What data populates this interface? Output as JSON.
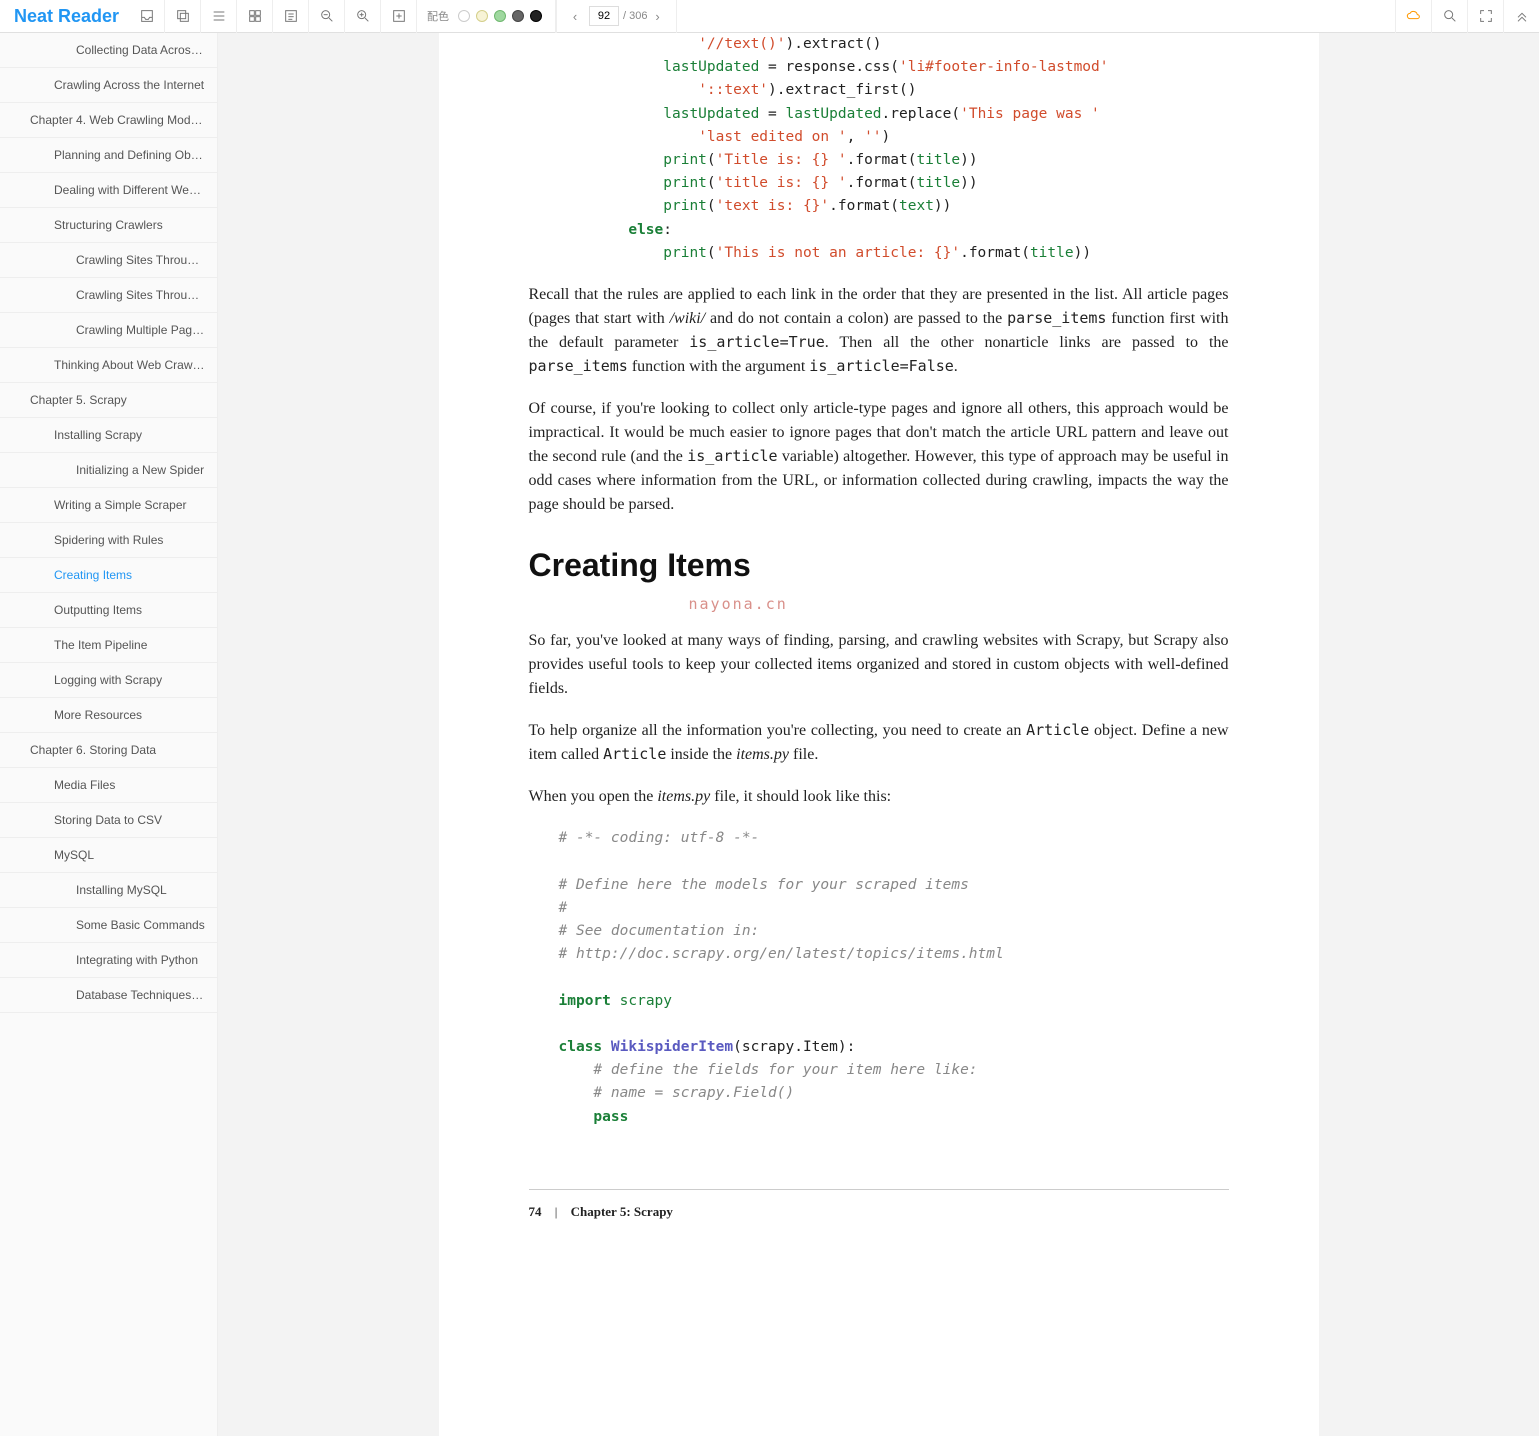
{
  "brand": "Neat Reader",
  "toolbar": {
    "color_label": "配色",
    "page_current": "92",
    "page_total": "/ 306"
  },
  "toc": [
    {
      "label": "Collecting Data Across …",
      "lvl": 3
    },
    {
      "label": "Crawling Across the Internet",
      "lvl": 2
    },
    {
      "label": "Chapter 4. Web Crawling Models",
      "lvl": 1
    },
    {
      "label": "Planning and Defining Objects",
      "lvl": 2
    },
    {
      "label": "Dealing with Different Websi…",
      "lvl": 2
    },
    {
      "label": "Structuring Crawlers",
      "lvl": 2
    },
    {
      "label": "Crawling Sites Through…",
      "lvl": 3
    },
    {
      "label": "Crawling Sites Through…",
      "lvl": 3
    },
    {
      "label": "Crawling Multiple Page …",
      "lvl": 3
    },
    {
      "label": "Thinking About Web Crawler…",
      "lvl": 2
    },
    {
      "label": "Chapter 5. Scrapy",
      "lvl": 1
    },
    {
      "label": "Installing Scrapy",
      "lvl": 2
    },
    {
      "label": "Initializing a New Spider",
      "lvl": 3
    },
    {
      "label": "Writing a Simple Scraper",
      "lvl": 2
    },
    {
      "label": "Spidering with Rules",
      "lvl": 2
    },
    {
      "label": "Creating Items",
      "lvl": 2,
      "active": true
    },
    {
      "label": "Outputting Items",
      "lvl": 2
    },
    {
      "label": "The Item Pipeline",
      "lvl": 2
    },
    {
      "label": "Logging with Scrapy",
      "lvl": 2
    },
    {
      "label": "More Resources",
      "lvl": 2
    },
    {
      "label": "Chapter 6. Storing Data",
      "lvl": 1
    },
    {
      "label": "Media Files",
      "lvl": 2
    },
    {
      "label": "Storing Data to CSV",
      "lvl": 2
    },
    {
      "label": "MySQL",
      "lvl": 2
    },
    {
      "label": "Installing MySQL",
      "lvl": 3
    },
    {
      "label": "Some Basic Commands",
      "lvl": 3
    },
    {
      "label": "Integrating with Python",
      "lvl": 3
    },
    {
      "label": "Database Techniques a…",
      "lvl": 3
    }
  ],
  "body": {
    "code1": {
      "l1a": "'//text()'",
      "l1b": ").extract()",
      "l2a": "lastUpdated",
      "l2b": " = response.css(",
      "l2c": "'li#footer-info-lastmod'",
      "l3a": "'::text'",
      "l3b": ").extract_first()",
      "l4a": "lastUpdated",
      "l4b": " = ",
      "l4c": "lastUpdated",
      "l4d": ".replace(",
      "l4e": "'This page was '",
      "l5a": "'last edited on '",
      "l5b": ", ",
      "l5c": "''",
      "l5d": ")",
      "l6a": "print",
      "l6b": "(",
      "l6c": "'Title is: {} '",
      "l6d": ".format(",
      "l6e": "title",
      "l6f": "))",
      "l7a": "print",
      "l7b": "(",
      "l7c": "'title is: {} '",
      "l7d": ".format(",
      "l7e": "title",
      "l7f": "))",
      "l8a": "print",
      "l8b": "(",
      "l8c": "'text is: {}'",
      "l8d": ".format(",
      "l8e": "text",
      "l8f": "))",
      "l9a": "else",
      "l9b": ":",
      "l10a": "print",
      "l10b": "(",
      "l10c": "'This is not an article: {}'",
      "l10d": ".format(",
      "l10e": "title",
      "l10f": "))"
    },
    "p1a": "Recall that the rules are applied to each link in the order that they are presented in the list. All article pages (pages that start with ",
    "p1b": "/wiki/",
    "p1c": " and do not contain a colon) are passed to the ",
    "p1d": "parse_items",
    "p1e": " function first with the default parameter ",
    "p1f": "is_article=True",
    "p1g": ". Then all the other nonarticle links are passed to the ",
    "p1h": "parse_items",
    "p1i": " function with the argument ",
    "p1j": "is_article=False",
    "p1k": ".",
    "p2a": "Of course, if you're looking to collect only article-type pages and ignore all others, this approach would be impractical. It would be much easier to ignore pages that don't match the article URL pattern and leave out the second rule (and the ",
    "p2b": "is_article",
    "p2c": " variable) altogether. However, this type of approach may be useful in odd cases where information from the URL, or information collected during crawling, impacts the way the page should be parsed.",
    "h1": "Creating Items",
    "watermark": "nayona.cn",
    "p3": "So far, you've looked at many ways of finding, parsing, and crawling websites with Scrapy, but Scrapy also provides useful tools to keep your collected items organized and stored in custom objects with well-defined fields.",
    "p4a": "To help organize all the information you're collecting, you need to create an ",
    "p4b": "Article",
    "p4c": " object. Define a new item called ",
    "p4d": "Article",
    "p4e": " inside the ",
    "p4f": "items.py",
    "p4g": " file.",
    "p5a": "When you open the ",
    "p5b": "items.py",
    "p5c": " file, it should look like this:",
    "code2": {
      "l1": "# -*- coding: utf-8 -*-",
      "l2": "# Define here the models for your scraped items",
      "l3": "#",
      "l4": "# See documentation in:",
      "l5": "# http://doc.scrapy.org/en/latest/topics/items.html",
      "l6a": "import",
      "l6b": " ",
      "l6c": "scrapy",
      "l7a": "class",
      "l7b": " ",
      "l7c": "WikispiderItem",
      "l7d": "(scrapy.Item):",
      "l8": "# define the fields for your item here like:",
      "l9": "# name = scrapy.Field()",
      "l10": "pass"
    },
    "footer_page": "74",
    "footer_sep": "|",
    "footer_chapter": "Chapter 5: Scrapy"
  }
}
